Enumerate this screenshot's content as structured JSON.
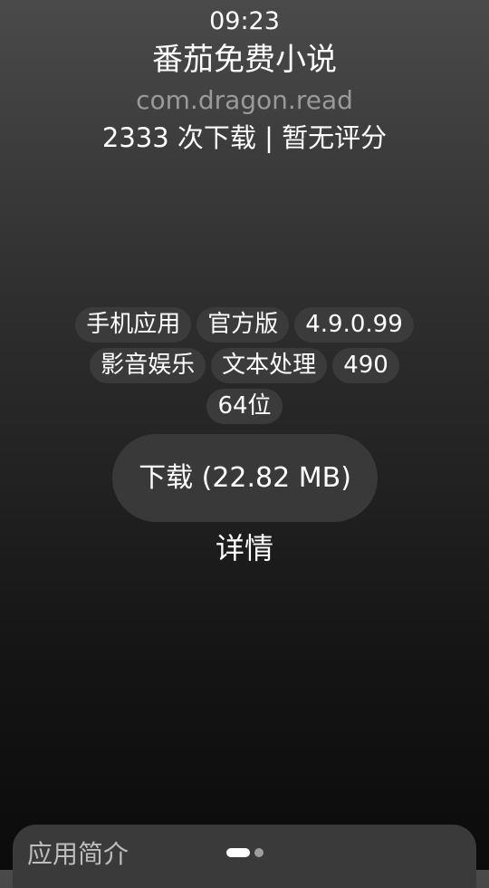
{
  "status_bar": {
    "time": "09:23"
  },
  "app": {
    "name": "番茄免费小说",
    "package": "com.dragon.read",
    "stats": "2333 次下载 | 暂无评分"
  },
  "tags": [
    "手机应用",
    "官方版",
    "4.9.0.99",
    "影音娱乐",
    "文本处理",
    "490",
    "64位"
  ],
  "download_button": {
    "label": "下载 (22.82 MB)"
  },
  "details_link": {
    "label": "详情"
  },
  "bottom_sheet": {
    "title": "应用简介",
    "pager": {
      "pages": 2,
      "active_page": 1
    }
  }
}
